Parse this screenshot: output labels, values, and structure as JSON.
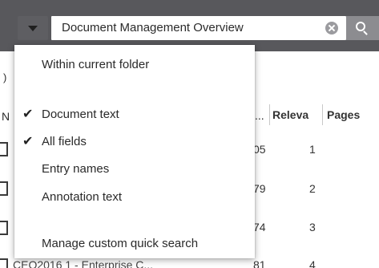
{
  "search": {
    "value": "Document Management Overview"
  },
  "background": {
    "partial_paren": ")",
    "header_name_fragment": "N",
    "header_dots": "...",
    "header_relevance": "Releva",
    "header_pages": "Pages",
    "rows": [
      {
        "col_a": "05",
        "col_b": "1"
      },
      {
        "col_a": "79",
        "col_b": "2"
      },
      {
        "col_a": "74",
        "col_b": "3"
      },
      {
        "col_a": "81",
        "col_b": "4"
      }
    ],
    "partial_row_text": "CEO2016 1 - Enterprise C..."
  },
  "menu": {
    "items": [
      {
        "label": "Within current folder",
        "checked": false
      },
      {
        "label": "Document text",
        "checked": true
      },
      {
        "label": "All fields",
        "checked": true
      },
      {
        "label": "Entry names",
        "checked": false
      },
      {
        "label": "Annotation text",
        "checked": false
      },
      {
        "label": "Manage custom quick search",
        "checked": false
      }
    ],
    "check_glyph": "✔"
  },
  "colors": {
    "topbar": "#58585c",
    "search_button": "#8c8c90"
  }
}
